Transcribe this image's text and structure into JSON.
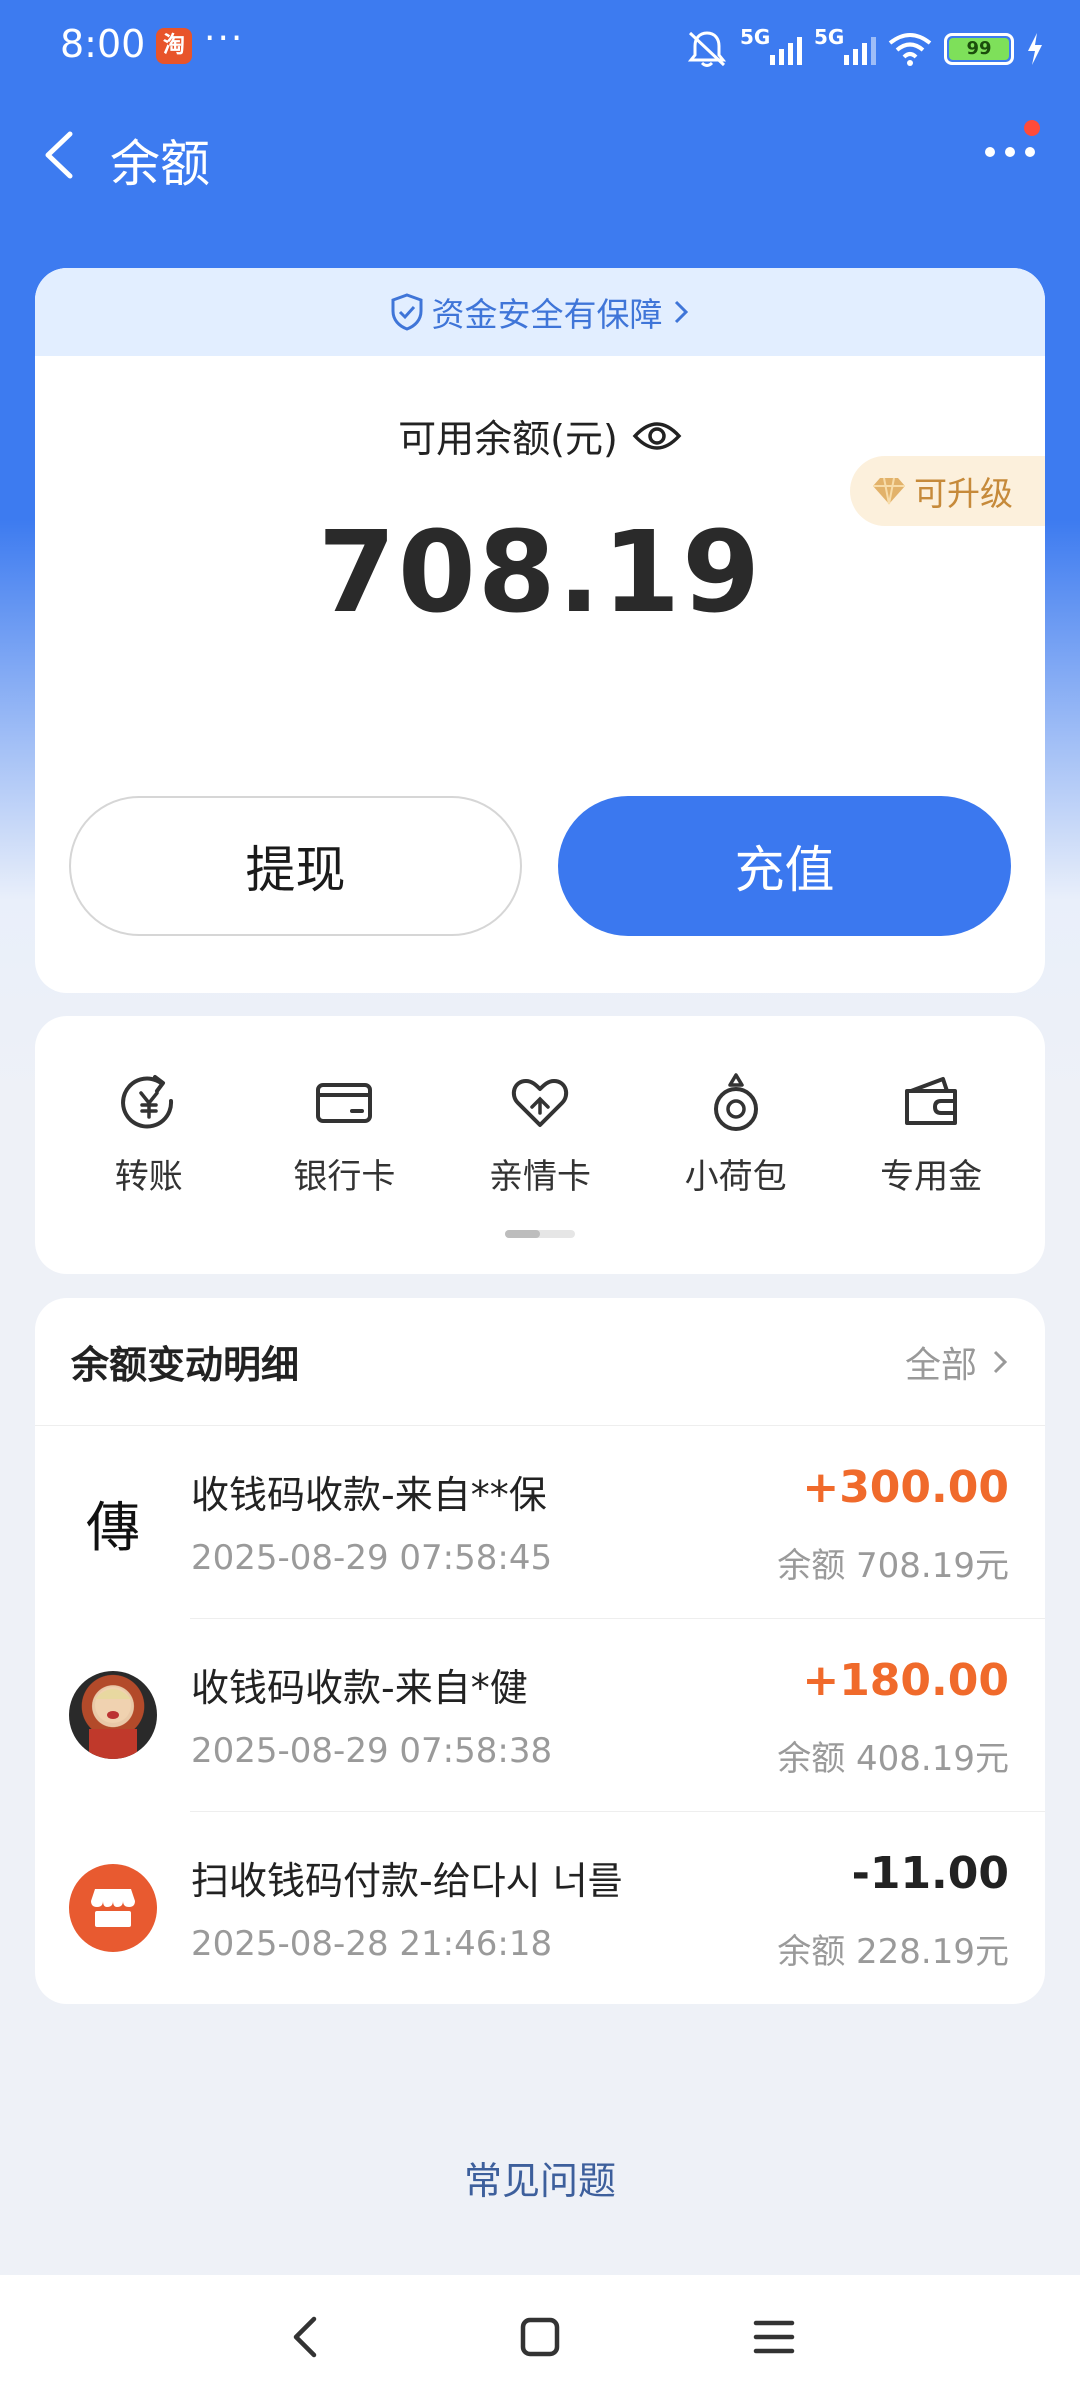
{
  "status_bar": {
    "time": "8:00",
    "app_badge": "淘",
    "dots": "···",
    "signal1_label": "5G",
    "signal2_label": "5G",
    "battery": "99"
  },
  "nav": {
    "title": "余额"
  },
  "balance_card": {
    "safety_banner": "资金安全有保障",
    "label": "可用余额(元)",
    "amount": "708.19",
    "upgrade": "可升级",
    "withdraw": "提现",
    "recharge": "充值"
  },
  "services": [
    {
      "label": "转账",
      "icon": "transfer-icon"
    },
    {
      "label": "银行卡",
      "icon": "bank-card-icon"
    },
    {
      "label": "亲情卡",
      "icon": "family-card-icon"
    },
    {
      "label": "小荷包",
      "icon": "small-purse-icon"
    },
    {
      "label": "专用金",
      "icon": "special-fund-icon"
    }
  ],
  "transactions": {
    "title": "余额变动明细",
    "all": "全部",
    "items": [
      {
        "avatar_char": "傳",
        "name": "收钱码收款-来自**保",
        "time": "2025-08-29 07:58:45",
        "amount": "+300.00",
        "balance": "余额 708.19元"
      },
      {
        "name": "收钱码收款-来自*健",
        "time": "2025-08-29 07:58:38",
        "amount": "+180.00",
        "balance": "余额 408.19元"
      },
      {
        "name": "扫收钱码付款-给다시 너를",
        "time": "2025-08-28 21:46:18",
        "amount": "-11.00",
        "balance": "余额 228.19元"
      }
    ]
  },
  "faq": "常见问题",
  "colors": {
    "primary": "#3b78ef",
    "income": "#f06a2b",
    "upgrade": "#c68a3a"
  }
}
